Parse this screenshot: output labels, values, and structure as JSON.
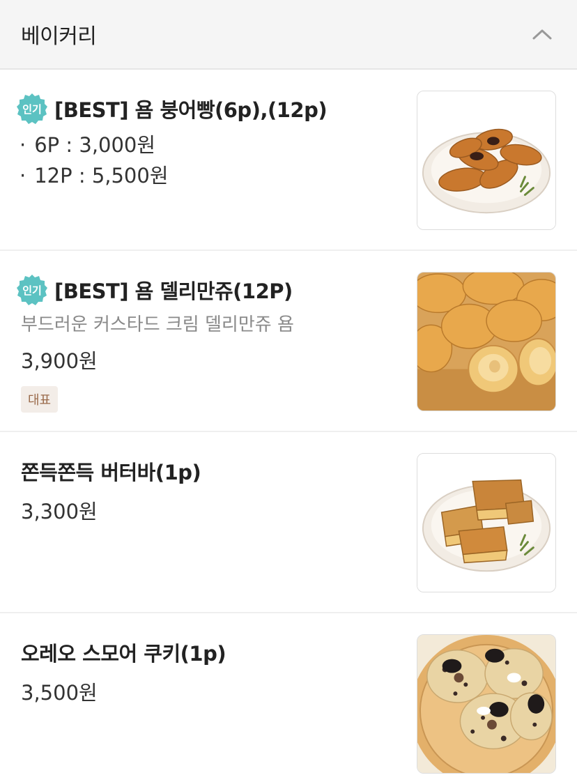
{
  "section": {
    "title": "베이커리",
    "collapse_icon": "chevron-up-icon"
  },
  "items": [
    {
      "badge": "인기",
      "name": "[BEST] 욤 붕어빵(6p),(12p)",
      "options": [
        {
          "bullet": "·",
          "label": "6P : 3,000원"
        },
        {
          "bullet": "·",
          "label": "12P : 5,500원"
        }
      ],
      "image": "taiyaki-photo"
    },
    {
      "badge": "인기",
      "name": "[BEST] 욤 델리만쥬(12P)",
      "description": "부드러운 커스타드 크림 델리만쥬 욤",
      "price": "3,900원",
      "tag": "대표",
      "image": "delimanjoo-photo"
    },
    {
      "name": "쫀득쫀득 버터바(1p)",
      "price": "3,300원",
      "image": "butter-bar-photo"
    },
    {
      "name": "오레오 스모어 쿠키(1p)",
      "price": "3,500원",
      "image": "oreo-smore-cookie-photo"
    }
  ],
  "colors": {
    "badge": "#5cc2c2",
    "tag_bg": "#f3ede8",
    "tag_text": "#9a6a4a",
    "header_bg": "#f5f5f5"
  }
}
